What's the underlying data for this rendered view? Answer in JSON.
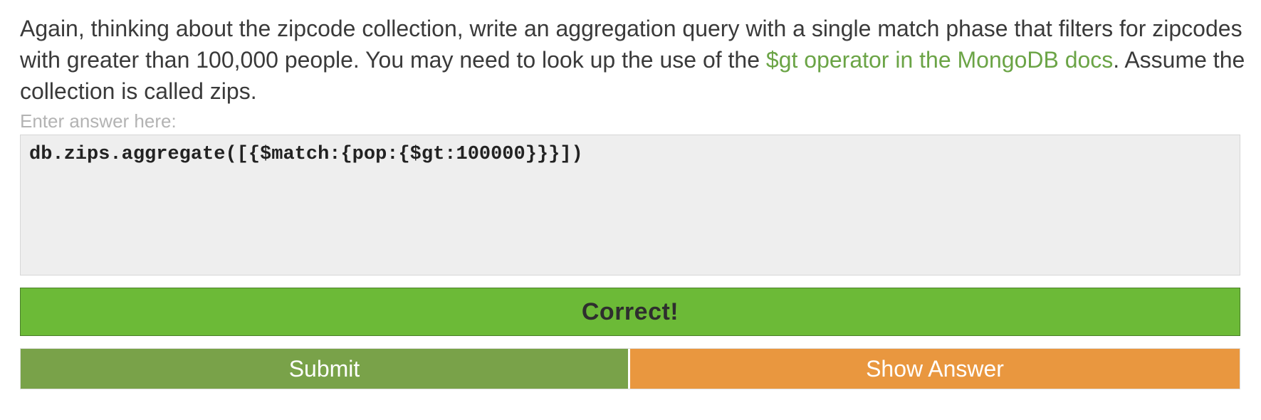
{
  "question": {
    "text_before": "Again, thinking about the zipcode collection, write an aggregation query with a single match phase that filters for zipcodes with greater than 100,000 people. You may need to look up the use of the ",
    "link_text": "$gt operator in the MongoDB docs",
    "text_after": ". Assume the collection is called zips."
  },
  "answer": {
    "label": "Enter answer here:",
    "value": "db.zips.aggregate([{$match:{pop:{$gt:100000}}}])"
  },
  "result": {
    "message": "Correct!"
  },
  "buttons": {
    "submit_label": "Submit",
    "show_answer_label": "Show Answer"
  },
  "colors": {
    "link": "#6ba446",
    "correct_banner": "#6cba37",
    "submit_button": "#79a249",
    "show_answer_button": "#e9973f"
  }
}
